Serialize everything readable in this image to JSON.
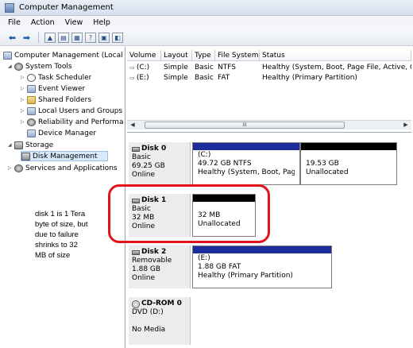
{
  "window": {
    "title": "Computer Management"
  },
  "menu": [
    "File",
    "Action",
    "View",
    "Help"
  ],
  "tree": {
    "root": "Computer Management (Local",
    "system_tools": "System Tools",
    "task_scheduler": "Task Scheduler",
    "event_viewer": "Event Viewer",
    "shared_folders": "Shared Folders",
    "local_users": "Local Users and Groups",
    "reliability": "Reliability and Performa",
    "device_manager": "Device Manager",
    "storage": "Storage",
    "disk_management": "Disk Management",
    "services": "Services and Applications"
  },
  "volumes": {
    "headers": [
      "Volume",
      "Layout",
      "Type",
      "File System",
      "Status"
    ],
    "rows": [
      [
        "(C:)",
        "Simple",
        "Basic",
        "NTFS",
        "Healthy (System, Boot, Page File, Active, Cra"
      ],
      [
        "(E:)",
        "Simple",
        "Basic",
        "FAT",
        "Healthy (Primary Partition)"
      ]
    ]
  },
  "scroll_grip": "III",
  "disks": {
    "disk0": {
      "name": "Disk 0",
      "type": "Basic",
      "size": "69.25 GB",
      "status": "Online",
      "p1_label": "(C:)",
      "p1_size": "49.72 GB NTFS",
      "p1_status": "Healthy (System, Boot, Page I",
      "p2_size": "19.53 GB",
      "p2_status": "Unallocated"
    },
    "disk1": {
      "name": "Disk 1",
      "type": "Basic",
      "size": "32 MB",
      "status": "Online",
      "p1_size": "32 MB",
      "p1_status": "Unallocated"
    },
    "disk2": {
      "name": "Disk 2",
      "type": "Removable",
      "size": "1.88 GB",
      "status": "Online",
      "p1_label": "(E:)",
      "p1_size": "1.88 GB FAT",
      "p1_status": "Healthy (Primary Partition)"
    },
    "cdrom0": {
      "name": "CD-ROM 0",
      "type": "DVD (D:)",
      "status": "No Media"
    }
  },
  "annotation": {
    "line1": "disk 1 is 1 Tera",
    "line2": "byte of size, but",
    "line3": "due to failure",
    "line4": "shrinks to 32",
    "line5": "MB of size"
  },
  "colors": {
    "primary_partition": "#1c2c9a",
    "unallocated": "#000000",
    "annotation_circle": "#e1141c"
  }
}
